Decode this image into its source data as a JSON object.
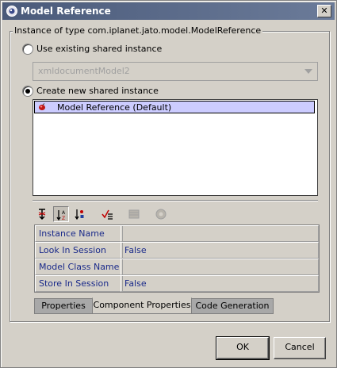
{
  "window": {
    "title": "Model Reference",
    "close_glyph": "✕"
  },
  "group": {
    "title": "Instance of type com.iplanet.jato.model.ModelReference"
  },
  "options": {
    "use_existing_label": "Use existing shared instance",
    "use_existing_selected": false,
    "existing_combo_value": "xmldocumentModel2",
    "create_new_label": "Create new shared instance",
    "create_new_selected": true
  },
  "instance_list": {
    "items": [
      {
        "label": "Model Reference (Default)",
        "icon": "bean-icon",
        "selected": true
      }
    ]
  },
  "toolbar": {
    "buttons": [
      {
        "icon": "unsorted-icon",
        "pressed": false
      },
      {
        "icon": "sort-by-name-icon",
        "pressed": true
      },
      {
        "icon": "sort-by-type-icon",
        "pressed": false
      },
      {
        "icon": "customize-icon",
        "pressed": false
      },
      {
        "icon": "property-sheet-icon",
        "pressed": false,
        "disabled": true
      },
      {
        "icon": "help-icon",
        "pressed": false,
        "disabled": true
      }
    ]
  },
  "properties": {
    "rows": [
      {
        "name": "Instance Name",
        "value": ""
      },
      {
        "name": "Look In Session",
        "value": "False"
      },
      {
        "name": "Model Class Name",
        "value": ""
      },
      {
        "name": "Store In Session",
        "value": "False"
      }
    ]
  },
  "tabs": [
    {
      "label": "Properties",
      "active": false
    },
    {
      "label": "Component Properties",
      "active": true
    },
    {
      "label": "Code Generation",
      "active": false
    }
  ],
  "buttons": {
    "ok": "OK",
    "cancel": "Cancel"
  },
  "colors": {
    "title_bar": "#4a5a7a",
    "selection": "#ccccff",
    "property_text": "#1a2a8a"
  }
}
